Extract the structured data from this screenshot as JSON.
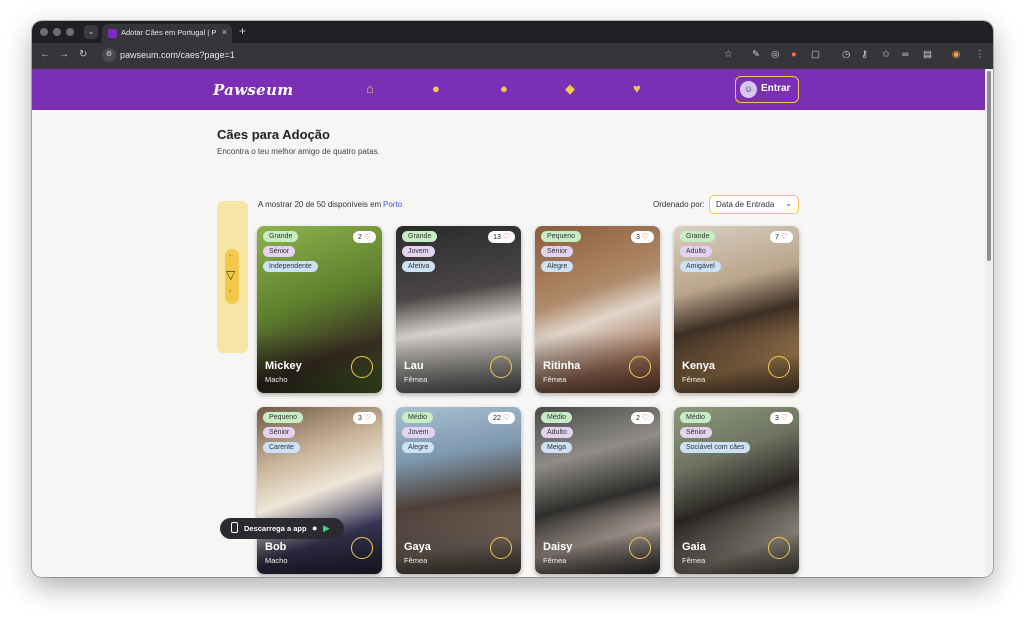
{
  "browser": {
    "tab_title": "Adotar Cães em Portugal | Pa",
    "tab_close": "×",
    "new_tab": "+",
    "url": "pawseum.com/caes?page=1"
  },
  "site": {
    "logo": "Pawseum",
    "login_label": "Entrar",
    "nav_icons": [
      "home-icon",
      "dog-icon",
      "cat-icon",
      "parrot-icon",
      "heart-icon"
    ]
  },
  "page": {
    "title": "Cães para Adoção",
    "subtitle": "Encontra o teu melhor amigo de quatro patas.",
    "results_text": "A mostrar 20 de 50 disponíveis em",
    "results_location": "Porto",
    "sort_label": "Ordenado por:",
    "sort_value": "Data de Entrada"
  },
  "colors": {
    "brand_purple": "#7a2fb4",
    "accent_yellow": "#f2c94c",
    "tag_size": "#c7edc4",
    "tag_age": "#e3d3f1",
    "tag_trait": "#cce1f6"
  },
  "dogs": [
    {
      "name": "Mickey",
      "sex": "Macho",
      "likes": "2",
      "tags": [
        "Grande",
        "Sénior",
        "Independente"
      ]
    },
    {
      "name": "Lau",
      "sex": "Fêmea",
      "likes": "13",
      "tags": [
        "Grande",
        "Jovem",
        "Afetiva"
      ]
    },
    {
      "name": "Ritinha",
      "sex": "Fêmea",
      "likes": "3",
      "tags": [
        "Pequeno",
        "Sénior",
        "Alegre"
      ]
    },
    {
      "name": "Kenya",
      "sex": "Fêmea",
      "likes": "7",
      "tags": [
        "Grande",
        "Adulto",
        "Amigável"
      ]
    },
    {
      "name": "Bob",
      "sex": "Macho",
      "likes": "3",
      "tags": [
        "Pequeno",
        "Sénior",
        "Carente"
      ]
    },
    {
      "name": "Gaya",
      "sex": "Fêmea",
      "likes": "22",
      "tags": [
        "Médio",
        "Jovem",
        "Alegre"
      ]
    },
    {
      "name": "Daisy",
      "sex": "Fêmea",
      "likes": "2",
      "tags": [
        "Médio",
        "Adulto",
        "Meiga"
      ]
    },
    {
      "name": "Gaia",
      "sex": "Fêmea",
      "likes": "3",
      "tags": [
        "Médio",
        "Sénior",
        "Sociável com cães"
      ]
    }
  ],
  "app_banner": {
    "label": "Descarrega a app"
  }
}
